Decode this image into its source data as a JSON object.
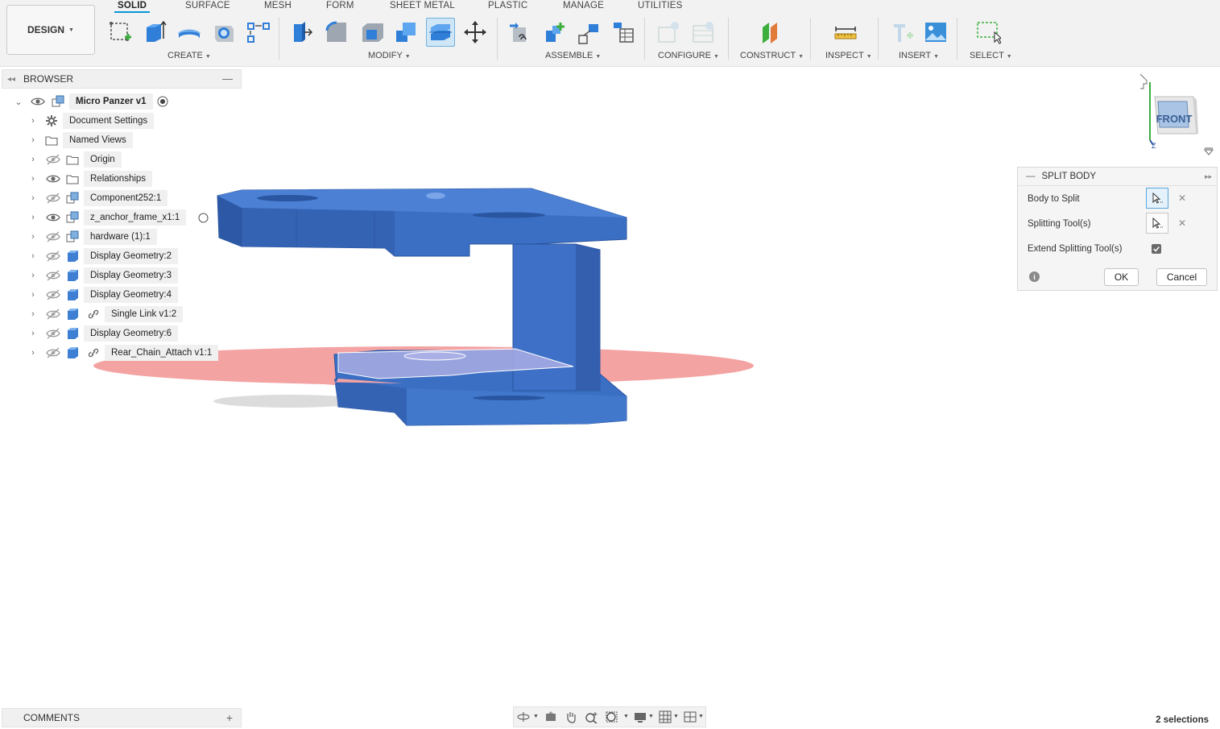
{
  "toolbar": {
    "workspace": "DESIGN",
    "tabs": [
      "SOLID",
      "SURFACE",
      "MESH",
      "FORM",
      "SHEET METAL",
      "PLASTIC",
      "MANAGE",
      "UTILITIES"
    ],
    "groups": {
      "create": "CREATE",
      "modify": "MODIFY",
      "assemble": "ASSEMBLE",
      "configure": "CONFIGURE",
      "construct": "CONSTRUCT",
      "inspect": "INSPECT",
      "insert": "INSERT",
      "select": "SELECT"
    }
  },
  "browser": {
    "title": "BROWSER",
    "root": "Micro Panzer v1",
    "items": [
      {
        "label": "Document Settings",
        "icon": "gear-icon",
        "eye": "none"
      },
      {
        "label": "Named Views",
        "icon": "folder-icon",
        "eye": "none"
      },
      {
        "label": "Origin",
        "icon": "folder-icon",
        "eye": "hidden"
      },
      {
        "label": "Relationships",
        "icon": "folder-icon",
        "eye": "visible"
      },
      {
        "label": "Component252:1",
        "icon": "component-icon",
        "eye": "hidden"
      },
      {
        "label": "z_anchor_frame_x1:1",
        "icon": "component-icon",
        "eye": "visible"
      },
      {
        "label": "hardware (1):1",
        "icon": "component-icon",
        "eye": "hidden"
      },
      {
        "label": "Display Geometry:2",
        "icon": "body-icon",
        "eye": "hidden"
      },
      {
        "label": "Display Geometry:3",
        "icon": "body-icon",
        "eye": "hidden"
      },
      {
        "label": "Display Geometry:4",
        "icon": "body-icon",
        "eye": "hidden"
      },
      {
        "label": "Single Link v1:2",
        "icon": "body-icon",
        "eye": "hidden",
        "linked": true
      },
      {
        "label": "Display Geometry:6",
        "icon": "body-icon",
        "eye": "hidden"
      },
      {
        "label": "Rear_Chain_Attach v1:1",
        "icon": "body-icon",
        "eye": "hidden",
        "linked": true
      }
    ]
  },
  "dialog": {
    "title": "SPLIT BODY",
    "body_to_split": "Body to Split",
    "splitting_tools": "Splitting Tool(s)",
    "extend": "Extend Splitting Tool(s)",
    "extend_checked": true,
    "ok": "OK",
    "cancel": "Cancel"
  },
  "viewcube": {
    "face": "FRONT",
    "axis_label": "Z"
  },
  "comments": {
    "title": "COMMENTS"
  },
  "status": {
    "selections": "2 selections"
  },
  "colors": {
    "accent": "#0696d7",
    "body": "#3b6fc4",
    "plane": "#f4a3a3"
  }
}
